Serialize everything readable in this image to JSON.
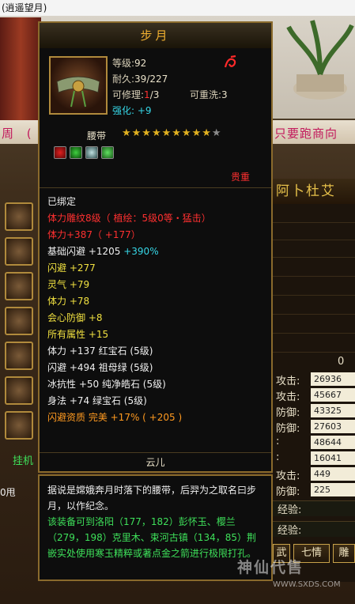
{
  "window": {
    "title_fragment": "(逍遥望月)"
  },
  "scene": {
    "banner_left": "周 (",
    "banner_right": "只要跑商向",
    "left_tag": "挂机",
    "left_small": "0甩"
  },
  "tooltip": {
    "name": "步月",
    "level_label": "等级:",
    "level": "92",
    "durability_label": "耐久:",
    "durability": "39/227",
    "repair_label": "可修理:",
    "repair_used": "1",
    "repair_total": "/3",
    "rewash_label": "可重洗:",
    "rewash": "3",
    "enhance_label": "强化:",
    "enhance": "+9",
    "type": "腰带",
    "stars_on": "★★★★★★★★★",
    "stars_off": "★",
    "noble": "贵重",
    "lines": [
      {
        "text": "已绑定",
        "color": "#f0f0f0"
      },
      {
        "text": "体力雕纹8级（ 植绘：5级0等・猛击）",
        "color": "#ff3030"
      },
      {
        "text": "体力+387（ +177）",
        "color": "#ff3030"
      },
      {
        "text": "基础闪避 +1205",
        "color": "#f0f0f0",
        "extra": "+390%",
        "extra_color": "#36d6e6"
      },
      {
        "text": "闪避  +277",
        "color": "#f0e040"
      },
      {
        "text": "灵气  +79",
        "color": "#f0e040"
      },
      {
        "text": "体力  +78",
        "color": "#f0e040"
      },
      {
        "text": "会心防御  +8",
        "color": "#f0e040"
      },
      {
        "text": "所有属性  +15",
        "color": "#f0e040"
      },
      {
        "text": "体力  +137  红宝石 (5级)",
        "color": "#f0f0f0"
      },
      {
        "text": "闪避  +494  祖母绿 (5级)",
        "color": "#f0f0f0"
      },
      {
        "text": "冰抗性  +50  纯净皓石 (5级)",
        "color": "#f0f0f0"
      },
      {
        "text": "身法  +74  绿宝石 (5级)",
        "color": "#f0f0f0"
      },
      {
        "text": "闪避资质    完美  +17%  ( +205 )",
        "color": "#ff9a20"
      }
    ],
    "owner": "云儿"
  },
  "description": {
    "white": "据说是嫦娥奔月时落下的腰带，后羿为之取名曰步月，以作纪念。",
    "green": "该装备可到洛阳（177，182）彭怀玉、樱兰（279，198）克里木、束河古镇（134，85）荆嵌实处使用寒玉精粹或著点金之箭进行极限打孔。"
  },
  "right_panel": {
    "title": "阿卜杜艾",
    "zero": "0",
    "stats": [
      {
        "label": "攻击:",
        "value": "26936"
      },
      {
        "label": "攻击:",
        "value": "45667"
      },
      {
        "label": "防御:",
        "value": "43325"
      },
      {
        "label": "防御:",
        "value": "27603"
      },
      {
        "label": ":",
        "value": "48644"
      },
      {
        "label": ":",
        "value": "16041"
      },
      {
        "label": "攻击:",
        "value": "449"
      },
      {
        "label": "防御:",
        "value": "225"
      }
    ],
    "exp1": "经验:",
    "exp2": "经验:",
    "buttons": [
      "武",
      "七情",
      "雕"
    ]
  },
  "watermark": {
    "text": "神仙代售",
    "url": "WWW.SXDS.COM"
  },
  "colors": {
    "gold": "#e6c04a",
    "frame": "#8a6a2c",
    "cyan": "#36d6e6",
    "red": "#ff3030",
    "yellow": "#f0e040",
    "green": "#3ee05a"
  }
}
